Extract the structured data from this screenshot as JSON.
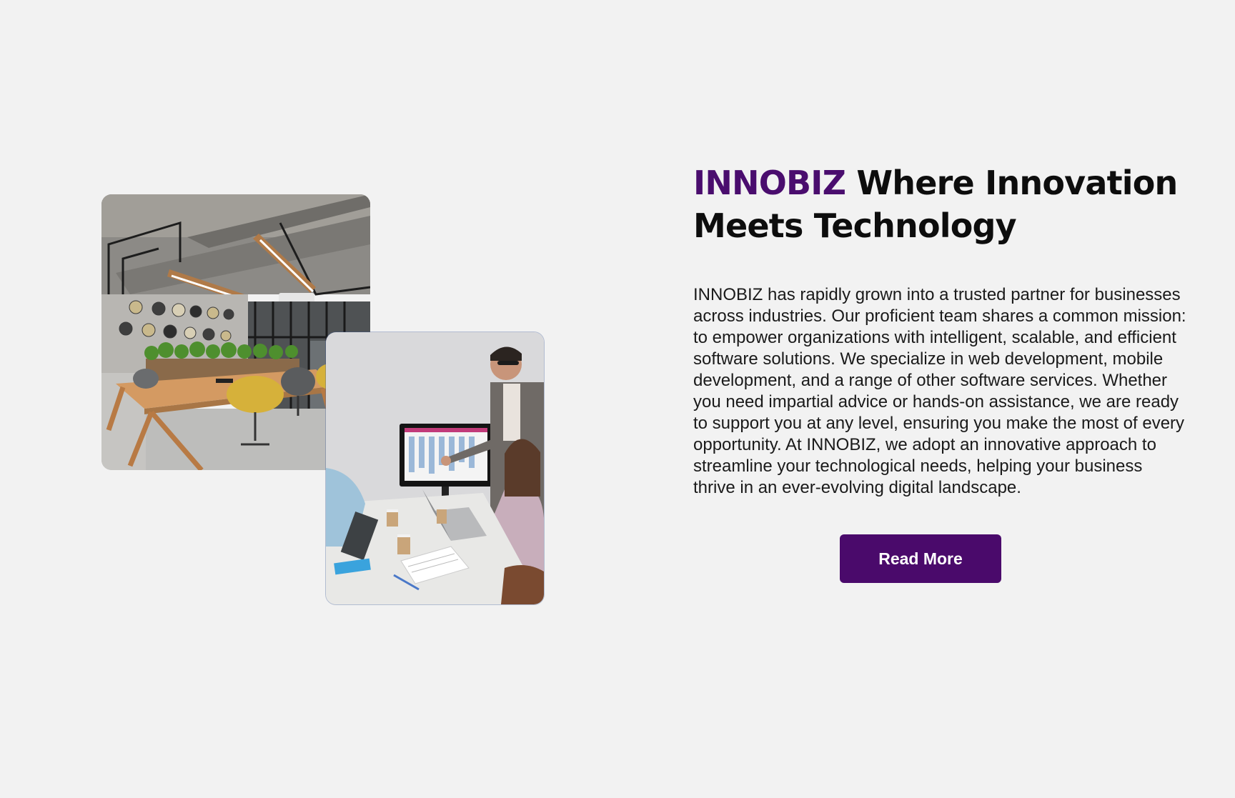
{
  "about": {
    "headline_brand": "INNOBIZ",
    "headline_rest": " Where Innovation Meets Technology",
    "description": "INNOBIZ has rapidly grown into a trusted partner for businesses across industries. Our proficient team shares a common mission: to empower organizations with intelligent, scalable, and efficient software solutions. We specialize in web development, mobile development, and a range of other software services. Whether you need impartial advice or hands-on assistance, we are ready to support you at any level, ensuring you make the most of every opportunity. At INNOBIZ, we adopt an innovative approach to streamline your technological needs, helping your business thrive in an ever-evolving digital landscape.",
    "cta_label": "Read More"
  },
  "images": {
    "office_photo": "office-interior-photo",
    "meeting_photo": "team-meeting-photo"
  },
  "colors": {
    "background": "#f2f2f2",
    "brand_purple": "#4a0d6e",
    "button_purple": "#4a0a6b",
    "heading_text": "#0d0d0d",
    "body_text": "#1a1a1a"
  }
}
